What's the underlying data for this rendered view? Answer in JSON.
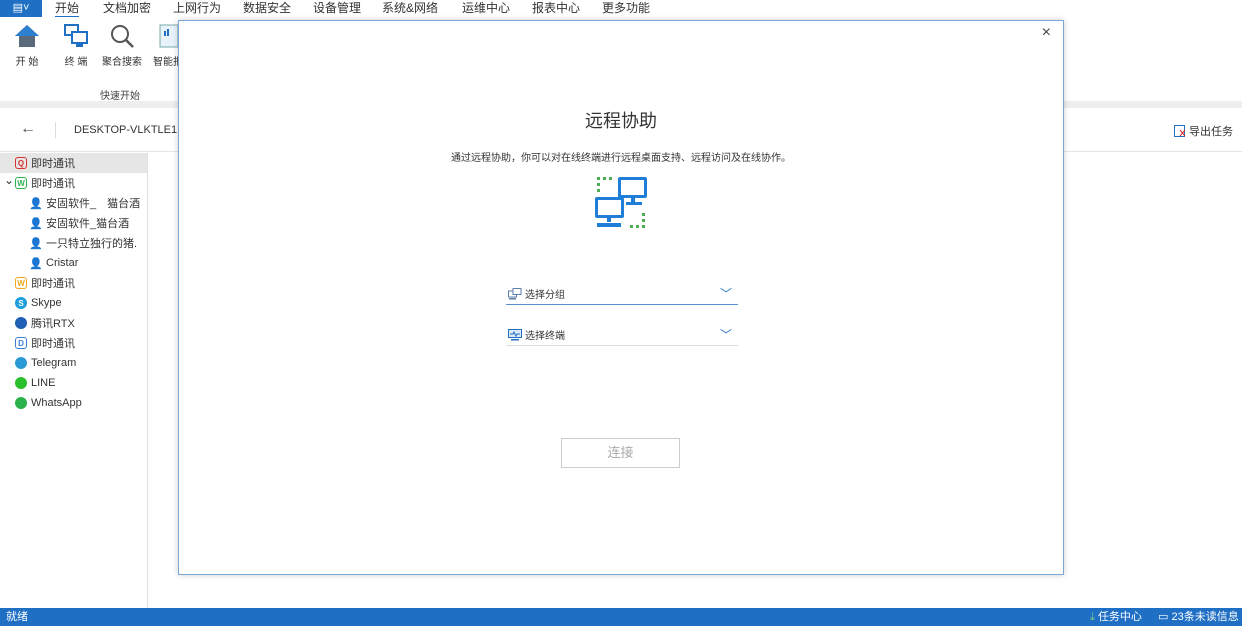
{
  "menubar": {
    "brand_icon": "app-menu-icon",
    "items": [
      "开始",
      "文档加密",
      "上网行为",
      "数据安全",
      "设备管理",
      "系统&网络",
      "运维中心",
      "报表中心",
      "更多功能"
    ]
  },
  "ribbon": {
    "buttons": [
      "开 始",
      "终 端",
      "聚合搜索",
      "智能报"
    ],
    "group": "快速开始"
  },
  "header": {
    "device": "DESKTOP-VLKTLE1",
    "export": "导出任务"
  },
  "sidebar": {
    "items": [
      {
        "label": "即时通讯",
        "icon": "Q",
        "color": "#d9302c",
        "indent": 0,
        "selected": true
      },
      {
        "label": "即时通讯",
        "icon": "W",
        "color": "#2bb24c",
        "indent": 0,
        "expanded": true
      },
      {
        "label": "安固软件_　猫台酒",
        "icon": "user",
        "color": "#3a6fb0",
        "indent": 1
      },
      {
        "label": "安固软件_猫台酒",
        "icon": "user",
        "color": "#3a6fb0",
        "indent": 1
      },
      {
        "label": "一只特立独行的猪.",
        "icon": "user",
        "color": "#3a6fb0",
        "indent": 1
      },
      {
        "label": "Cristar",
        "icon": "user",
        "color": "#3a6fb0",
        "indent": 1
      },
      {
        "label": "即时通讯",
        "icon": "W",
        "color": "#f0a818",
        "indent": 0
      },
      {
        "label": "Skype",
        "icon": "S",
        "color": "#1a9fdc",
        "indent": 0
      },
      {
        "label": "腾讯RTX",
        "icon": "rtx",
        "color": "#1f5fb5",
        "indent": 0
      },
      {
        "label": "即时通讯",
        "icon": "D",
        "color": "#3a7fd8",
        "indent": 0
      },
      {
        "label": "Telegram",
        "icon": "tg",
        "color": "#2a9ad6",
        "indent": 0
      },
      {
        "label": "LINE",
        "icon": "line",
        "color": "#2bc02b",
        "indent": 0
      },
      {
        "label": "WhatsApp",
        "icon": "wa",
        "color": "#2bb24c",
        "indent": 0
      }
    ]
  },
  "modal": {
    "title": "远程协助",
    "description": "通过远程协助，你可以对在线终端进行远程桌面支持、远程访问及在线协作。",
    "group_placeholder": "选择分组",
    "terminal_placeholder": "选择终端",
    "connect": "连接",
    "close": "×"
  },
  "status": {
    "left": "就绪",
    "tasks": "任务中心",
    "messages": "23条未读信息"
  },
  "colors": {
    "accent": "#1f6fc5",
    "green": "#4caf50"
  }
}
